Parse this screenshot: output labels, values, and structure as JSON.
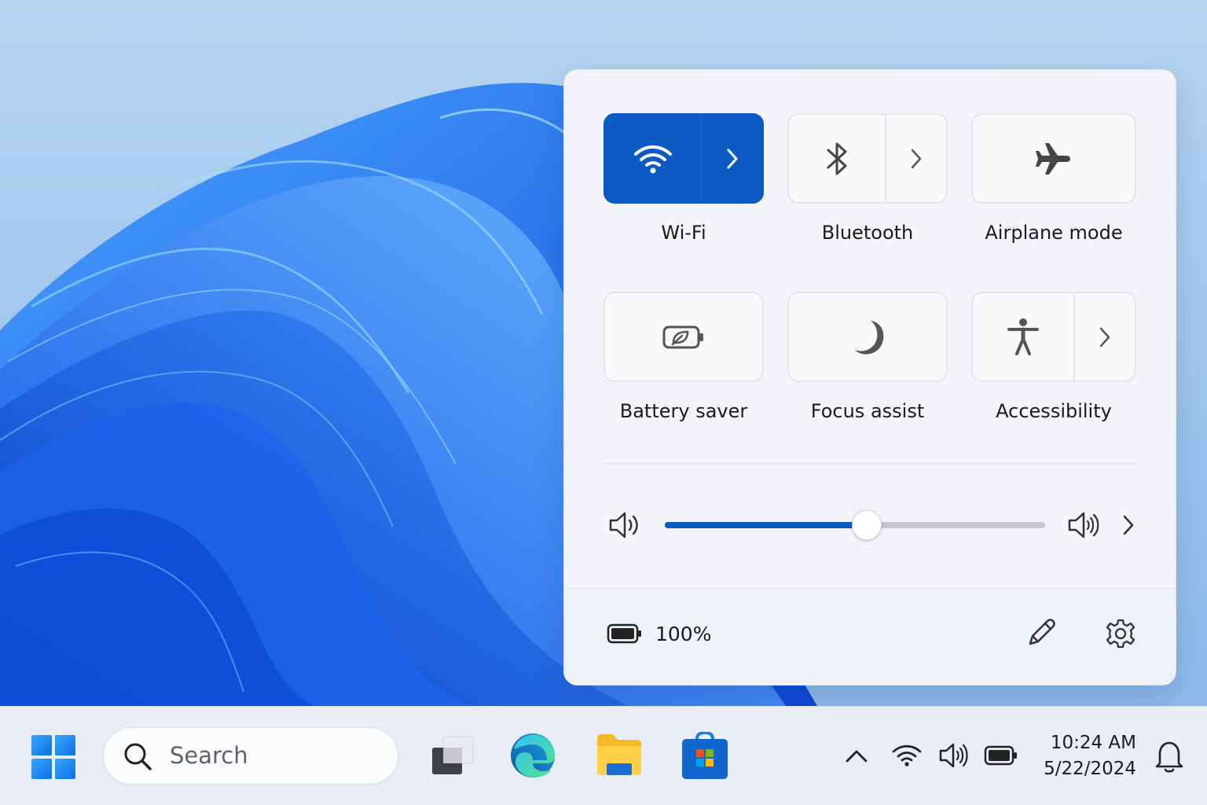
{
  "quick_settings": {
    "tiles": [
      {
        "label": "Wi-Fi",
        "icon": "wifi-icon",
        "active": true,
        "has_arrow": true
      },
      {
        "label": "Bluetooth",
        "icon": "bluetooth-icon",
        "active": false,
        "has_arrow": true
      },
      {
        "label": "Airplane mode",
        "icon": "airplane-icon",
        "active": false,
        "has_arrow": false
      },
      {
        "label": "Battery saver",
        "icon": "battery-saver-icon",
        "active": false,
        "has_arrow": false
      },
      {
        "label": "Focus assist",
        "icon": "moon-icon",
        "active": false,
        "has_arrow": false
      },
      {
        "label": "Accessibility",
        "icon": "accessibility-icon",
        "active": false,
        "has_arrow": true
      }
    ],
    "volume": {
      "level_percent": 53
    },
    "battery": {
      "percent_label": "100%"
    },
    "colors": {
      "accent": "#0a5ac2",
      "panel": "#f3f5f9"
    }
  },
  "taskbar": {
    "search_placeholder": "Search",
    "pinned_apps": [
      "task-view-icon",
      "edge-icon",
      "file-explorer-icon",
      "microsoft-store-icon"
    ],
    "tray_icons": [
      "chevron-up-icon",
      "wifi-icon",
      "speaker-icon",
      "battery-icon"
    ],
    "clock": {
      "time": "10:24 AM",
      "date": "5/22/2024"
    },
    "notification_icon": "bell-icon"
  }
}
